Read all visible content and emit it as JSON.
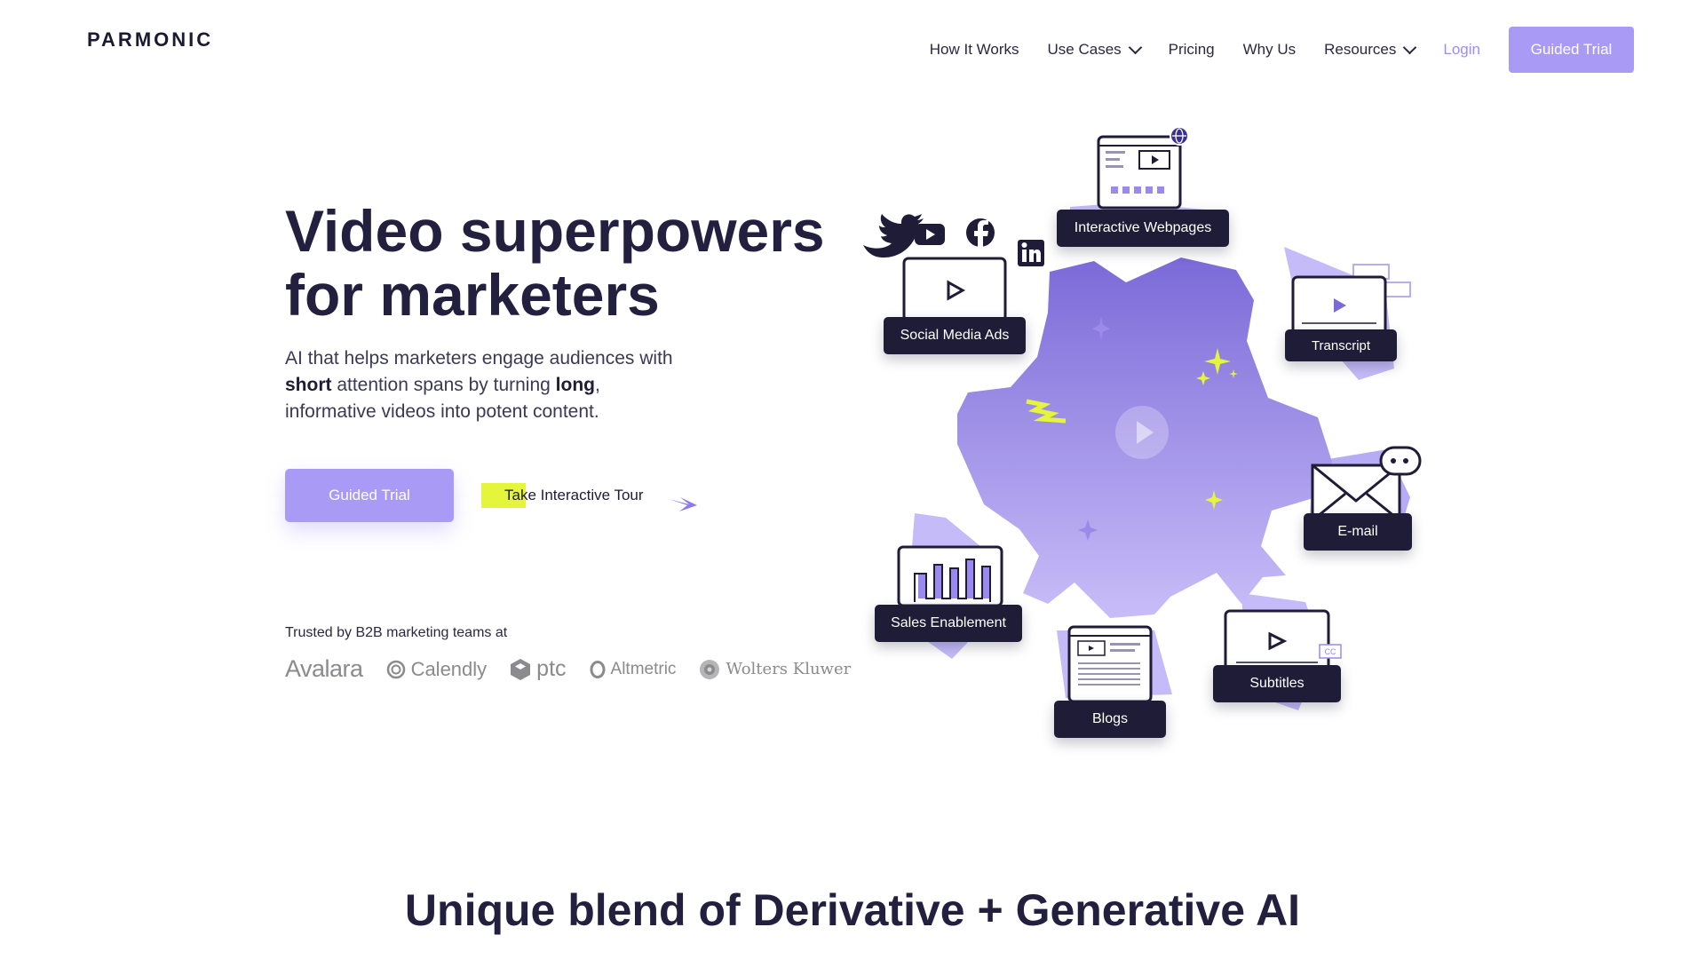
{
  "brand": {
    "name": "PARMONIC"
  },
  "nav": {
    "items": [
      {
        "label": "How It Works",
        "has_dropdown": false
      },
      {
        "label": "Use Cases",
        "has_dropdown": true
      },
      {
        "label": "Pricing",
        "has_dropdown": false
      },
      {
        "label": "Why Us",
        "has_dropdown": false
      },
      {
        "label": "Resources",
        "has_dropdown": true
      }
    ],
    "login": "Login",
    "cta": "Guided Trial"
  },
  "hero": {
    "title_line1": "Video superpowers",
    "title_line2": "for marketers",
    "subtitle_p1": "AI that helps marketers engage audiences with ",
    "subtitle_b1": "short",
    "subtitle_p2": " attention spans by turning ",
    "subtitle_b2": "long",
    "subtitle_p3": ", informative videos into potent content.",
    "primary_button": "Guided Trial",
    "tour_link": "Take Interactive Tour",
    "trusted_label": "Trusted by B2B marketing teams at",
    "logos": [
      "Avalara",
      "Calendly",
      "ptc",
      "Altmetric",
      "Wolters Kluwer"
    ]
  },
  "illustration": {
    "tags": {
      "webpages": "Interactive Webpages",
      "social": "Social Media Ads",
      "transcript": "Transcript",
      "email": "E-mail",
      "sales": "Sales Enablement",
      "blogs": "Blogs",
      "subtitles": "Subtitles"
    },
    "social_icons": [
      "twitter-icon",
      "youtube-icon",
      "facebook-icon",
      "linkedin-icon"
    ],
    "subtitles_badge": "CC"
  },
  "section2": {
    "title": "Unique blend of Derivative + Generative AI"
  },
  "colors": {
    "accent": "#a99af6",
    "dark": "#1e1c36",
    "highlight": "#e4f53c",
    "gear_top": "#7b6ad8",
    "gear_bottom": "#c9bdf8"
  }
}
